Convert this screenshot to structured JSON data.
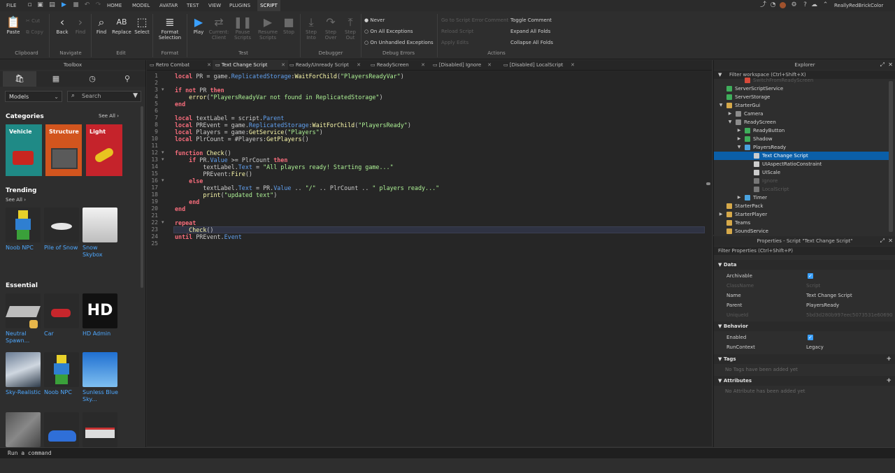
{
  "menubar": {
    "items": [
      "FILE",
      "HOME",
      "MODEL",
      "AVATAR",
      "TEST",
      "VIEW",
      "PLUGINS",
      "SCRIPT"
    ],
    "active": "SCRIPT",
    "username": "ReallyRedBrickColor"
  },
  "ribbon": {
    "clipboard": {
      "paste": "Paste",
      "cut": "Cut",
      "copy": "Copy",
      "label": "Clipboard"
    },
    "navigate": {
      "back": "Back",
      "find_next": "Find",
      "label": "Navigate"
    },
    "edit": {
      "find": "Find",
      "replace": "Replace",
      "select": "Select",
      "label": "Edit"
    },
    "format": {
      "format_selection": "Format Selection",
      "label": "Format"
    },
    "test": {
      "play": "Play",
      "current_client": "Current: Client",
      "pause_scripts": "Pause Scripts",
      "resume_scripts": "Resume Scripts",
      "stop": "Stop",
      "label": "Test"
    },
    "debugger": {
      "step_into": "Step Into",
      "step_over": "Step Over",
      "step_out": "Step Out",
      "label": "Debugger"
    },
    "debug_errors": {
      "never": "Never",
      "on_all": "On All Exceptions",
      "on_unhandled": "On Unhandled Exceptions",
      "label": "Debug Errors"
    },
    "actions": {
      "goto_script_error": "Go to Script Error",
      "comment": "Comment",
      "reload_script": "Reload Script",
      "apply_edits": "Apply Edits",
      "toggle_comment": "Toggle Comment",
      "expand_all": "Expand All Folds",
      "collapse_all": "Collapse All Folds",
      "label": "Actions"
    }
  },
  "toolbox": {
    "title": "Toolbox",
    "category_select": "Models",
    "search_placeholder": "Search",
    "categories_title": "Categories",
    "categories_see_all": "See All",
    "categories": [
      {
        "label": "Vehicle",
        "color": "#1f8a86"
      },
      {
        "label": "Structure",
        "color": "#d2551e"
      },
      {
        "label": "Light",
        "color": "#c5232b"
      }
    ],
    "trending_title": "Trending",
    "trending_see_all": "See All",
    "trending": [
      "Noob NPC",
      "Pile of Snow",
      "Snow Skybox"
    ],
    "essential_title": "Essential",
    "essential": [
      "Neutral Spawn...",
      "Car",
      "HD Admin",
      "Sky-Realistic",
      "Noob NPC",
      "Sunless Blue Sky..."
    ],
    "hd_text": "HD"
  },
  "tabs": [
    {
      "label": "Retro Combat"
    },
    {
      "label": "Text Change Script",
      "active": true
    },
    {
      "label": "Ready/Unready Script"
    },
    {
      "label": "ReadyScreen"
    },
    {
      "label": "[Disabled] Ignore"
    },
    {
      "label": "[Disabled] LocalScript"
    }
  ],
  "code": {
    "current_line": 23,
    "lines": [
      [
        [
          "kw",
          "local"
        ],
        [
          "op",
          " PR = game."
        ],
        [
          "prop",
          "ReplicatedStorage"
        ],
        [
          "op",
          ":"
        ],
        [
          "fn",
          "WaitForChild"
        ],
        [
          "op",
          "("
        ],
        [
          "str",
          "\"PlayersReadyVar\""
        ],
        [
          "op",
          ")"
        ]
      ],
      [],
      [
        [
          "kw",
          "if not"
        ],
        [
          "op",
          " PR "
        ],
        [
          "kw",
          "then"
        ]
      ],
      [
        [
          "op",
          "    "
        ],
        [
          "fn",
          "error"
        ],
        [
          "op",
          "("
        ],
        [
          "str",
          "\"PlayersReadyVar not found in ReplicatedStorage\""
        ],
        [
          "op",
          ")"
        ]
      ],
      [
        [
          "kw",
          "end"
        ]
      ],
      [],
      [
        [
          "kw",
          "local"
        ],
        [
          "op",
          " textLabel = script."
        ],
        [
          "prop",
          "Parent"
        ]
      ],
      [
        [
          "kw",
          "local"
        ],
        [
          "op",
          " PREvent = game."
        ],
        [
          "prop",
          "ReplicatedStorage"
        ],
        [
          "op",
          ":"
        ],
        [
          "fn",
          "WaitForChild"
        ],
        [
          "op",
          "("
        ],
        [
          "str",
          "\"PlayersReady\""
        ],
        [
          "op",
          ")"
        ]
      ],
      [
        [
          "kw",
          "local"
        ],
        [
          "op",
          " Players = game:"
        ],
        [
          "fn",
          "GetService"
        ],
        [
          "op",
          "("
        ],
        [
          "str",
          "\"Players\""
        ],
        [
          "op",
          ")"
        ]
      ],
      [
        [
          "kw",
          "local"
        ],
        [
          "op",
          " PlrCount = #Players:"
        ],
        [
          "fn",
          "GetPlayers"
        ],
        [
          "op",
          "()"
        ]
      ],
      [],
      [
        [
          "kw",
          "function"
        ],
        [
          "op",
          " "
        ],
        [
          "fn",
          "Check"
        ],
        [
          "op",
          "()"
        ]
      ],
      [
        [
          "op",
          "    "
        ],
        [
          "kw",
          "if"
        ],
        [
          "op",
          " PR."
        ],
        [
          "prop",
          "Value"
        ],
        [
          "op",
          " >= PlrCount "
        ],
        [
          "kw",
          "then"
        ]
      ],
      [
        [
          "op",
          "        textLabel."
        ],
        [
          "prop",
          "Text"
        ],
        [
          "op",
          " = "
        ],
        [
          "str",
          "\"All players ready! Starting game...\""
        ]
      ],
      [
        [
          "op",
          "        PREvent:"
        ],
        [
          "fn",
          "Fire"
        ],
        [
          "op",
          "()"
        ]
      ],
      [
        [
          "op",
          "    "
        ],
        [
          "kw",
          "else"
        ]
      ],
      [
        [
          "op",
          "        textLabel."
        ],
        [
          "prop",
          "Text"
        ],
        [
          "op",
          " = PR."
        ],
        [
          "prop",
          "Value"
        ],
        [
          "op",
          " .. "
        ],
        [
          "str",
          "\"/\""
        ],
        [
          "op",
          " .. PlrCount .. "
        ],
        [
          "str",
          "\" players ready...\""
        ]
      ],
      [
        [
          "op",
          "        "
        ],
        [
          "fn",
          "print"
        ],
        [
          "op",
          "("
        ],
        [
          "str",
          "\"updated text\""
        ],
        [
          "op",
          ")"
        ]
      ],
      [
        [
          "op",
          "    "
        ],
        [
          "kw",
          "end"
        ]
      ],
      [
        [
          "kw",
          "end"
        ]
      ],
      [],
      [
        [
          "kw",
          "repeat"
        ]
      ],
      [
        [
          "op",
          "    "
        ],
        [
          "fn",
          "Check"
        ],
        [
          "op",
          "()"
        ]
      ],
      [
        [
          "kw",
          "until"
        ],
        [
          "op",
          " PREvent."
        ],
        [
          "prop",
          "Event"
        ]
      ],
      []
    ]
  },
  "command_bar": {
    "placeholder": "Run a command"
  },
  "explorer": {
    "title": "Explorer",
    "filter_placeholder": "Filter workspace (Ctrl+Shift+X)",
    "rows": [
      {
        "label": "SwitchFromReadyScreen",
        "depth": 2,
        "arrow": "",
        "icon": "#d84a3a",
        "dim": true
      },
      {
        "label": "ServerScriptService",
        "depth": 0,
        "arrow": "",
        "icon": "#3fae5b"
      },
      {
        "label": "ServerStorage",
        "depth": 0,
        "arrow": "",
        "icon": "#3fae5b"
      },
      {
        "label": "StarterGui",
        "depth": 0,
        "arrow": "▼",
        "icon": "#d6a94a"
      },
      {
        "label": "Camera",
        "depth": 1,
        "arrow": "▶",
        "icon": "#8c8c8c"
      },
      {
        "label": "ReadyScreen",
        "depth": 1,
        "arrow": "▼",
        "icon": "#8c8c8c"
      },
      {
        "label": "ReadyButton",
        "depth": 2,
        "arrow": "▶",
        "icon": "#3fae5b"
      },
      {
        "label": "Shadow",
        "depth": 2,
        "arrow": "▶",
        "icon": "#3fae5b"
      },
      {
        "label": "PlayersReady",
        "depth": 2,
        "arrow": "▼",
        "icon": "#4aa3e0"
      },
      {
        "label": "Text Change Script",
        "depth": 3,
        "arrow": "",
        "icon": "#cccccc",
        "selected": true
      },
      {
        "label": "UIAspectRatioConstraint",
        "depth": 3,
        "arrow": "",
        "icon": "#cccccc"
      },
      {
        "label": "UIScale",
        "depth": 3,
        "arrow": "",
        "icon": "#cccccc"
      },
      {
        "label": "Ignore",
        "depth": 3,
        "arrow": "",
        "icon": "#777777",
        "dim": true
      },
      {
        "label": "LocalScript",
        "depth": 3,
        "arrow": "",
        "icon": "#777777",
        "dim": true
      },
      {
        "label": "Timer",
        "depth": 2,
        "arrow": "▶",
        "icon": "#4aa3e0"
      },
      {
        "label": "StarterPack",
        "depth": 0,
        "arrow": "",
        "icon": "#d6a94a"
      },
      {
        "label": "StarterPlayer",
        "depth": 0,
        "arrow": "▶",
        "icon": "#d6a94a"
      },
      {
        "label": "Teams",
        "depth": 0,
        "arrow": "",
        "icon": "#d6a94a"
      },
      {
        "label": "SoundService",
        "depth": 0,
        "arrow": "",
        "icon": "#d6a94a"
      }
    ]
  },
  "properties": {
    "title": "Properties - Script \"Text Change Script\"",
    "filter_placeholder": "Filter Properties (Ctrl+Shift+P)",
    "data_section": "Data",
    "archivable": "Archivable",
    "classname_k": "ClassName",
    "classname_v": "Script",
    "name_k": "Name",
    "name_v": "Text Change Script",
    "parent_k": "Parent",
    "parent_v": "PlayersReady",
    "uniqueid_k": "UniqueId",
    "uniqueid_v": "5bd3d280b997eec5073531e60690",
    "behavior_section": "Behavior",
    "enabled": "Enabled",
    "runcontext_k": "RunContext",
    "runcontext_v": "Legacy",
    "tags_section": "Tags",
    "tags_empty": "No Tags have been added yet",
    "attributes_section": "Attributes",
    "attributes_empty": "No Attribute has been added yet"
  }
}
